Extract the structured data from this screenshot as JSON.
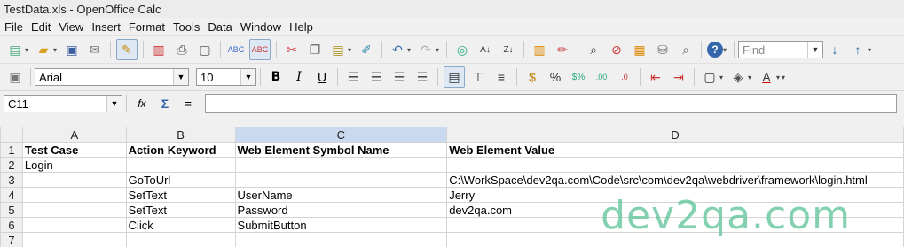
{
  "window": {
    "title": "TestData.xls - OpenOffice Calc"
  },
  "menu": [
    "File",
    "Edit",
    "View",
    "Insert",
    "Format",
    "Tools",
    "Data",
    "Window",
    "Help"
  ],
  "find": {
    "placeholder": "Find"
  },
  "format": {
    "font": "Arial",
    "size": "10"
  },
  "formula": {
    "cell_ref": "C11",
    "value": ""
  },
  "sheet": {
    "columns": [
      "A",
      "B",
      "C",
      "D"
    ],
    "rows": [
      {
        "num": "1",
        "cells": [
          "Test Case",
          "Action Keyword",
          "Web Element Symbol Name",
          "Web Element Value"
        ]
      },
      {
        "num": "2",
        "cells": [
          "Login",
          "",
          "",
          ""
        ]
      },
      {
        "num": "3",
        "cells": [
          "",
          "GoToUrl",
          "",
          "C:\\WorkSpace\\dev2qa.com\\Code\\src\\com\\dev2qa\\webdriver\\framework\\login.html"
        ]
      },
      {
        "num": "4",
        "cells": [
          "",
          "SetText",
          "UserName",
          "Jerry"
        ]
      },
      {
        "num": "5",
        "cells": [
          "",
          "SetText",
          "Password",
          "dev2qa.com"
        ]
      },
      {
        "num": "6",
        "cells": [
          "",
          "Click",
          "SubmitButton",
          ""
        ]
      },
      {
        "num": "7",
        "cells": [
          "",
          "",
          "",
          ""
        ]
      }
    ]
  },
  "watermark": "dev2qa.com"
}
